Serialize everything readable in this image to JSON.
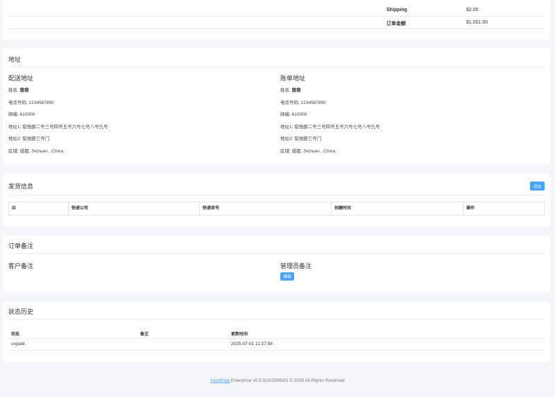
{
  "totals": {
    "rows": [
      {
        "label": "Shipping",
        "value": "$2.00"
      },
      {
        "label": "订单金额",
        "value": "$1,001.00"
      }
    ]
  },
  "address": {
    "title": "地址",
    "shipping": {
      "title": "配送地址",
      "name_label": "姓名:",
      "name": "蓉蓉",
      "phone": "电话号码: 1234567890",
      "zip": "邮编: 610000",
      "addr1": "地址1: 铂悦郡二号三号四号五号六号七号八号九号",
      "addr2": "地址2: 铂悦郡三号门",
      "region": "区域: 成都, Sichuan , China"
    },
    "billing": {
      "title": "账单地址",
      "name_label": "姓名:",
      "name": "蓉蓉",
      "phone": "电话号码: 1234567890",
      "zip": "邮编: 610000",
      "addr1": "地址1: 铂悦郡二号三号四号五号六号七号八号九号",
      "addr2": "地址2: 铂悦郡三号门",
      "region": "区域: 成都, Sichuan , China"
    }
  },
  "shipping_info": {
    "title": "发货信息",
    "add_label": "添加",
    "columns": [
      "ID",
      "快递公司",
      "快递单号",
      "创建时间",
      "操作"
    ]
  },
  "notes": {
    "title": "订单备注",
    "customer_label": "客户备注",
    "admin_label": "管理员备注",
    "edit_label": "编辑"
  },
  "history": {
    "title": "状态历史",
    "columns": [
      "状态",
      "备注",
      "更新时间"
    ],
    "rows": [
      {
        "status": "unpaid",
        "note": "",
        "updated": "2025-07-01 11:27:58"
      }
    ]
  },
  "footer": {
    "brand": "InnoShop",
    "text": " Enterprise v0.5.0(20250630) © 2025 All Rights Reserved"
  },
  "colors": {
    "accent": "#4aa3ff",
    "background": "#f4f6f9"
  }
}
